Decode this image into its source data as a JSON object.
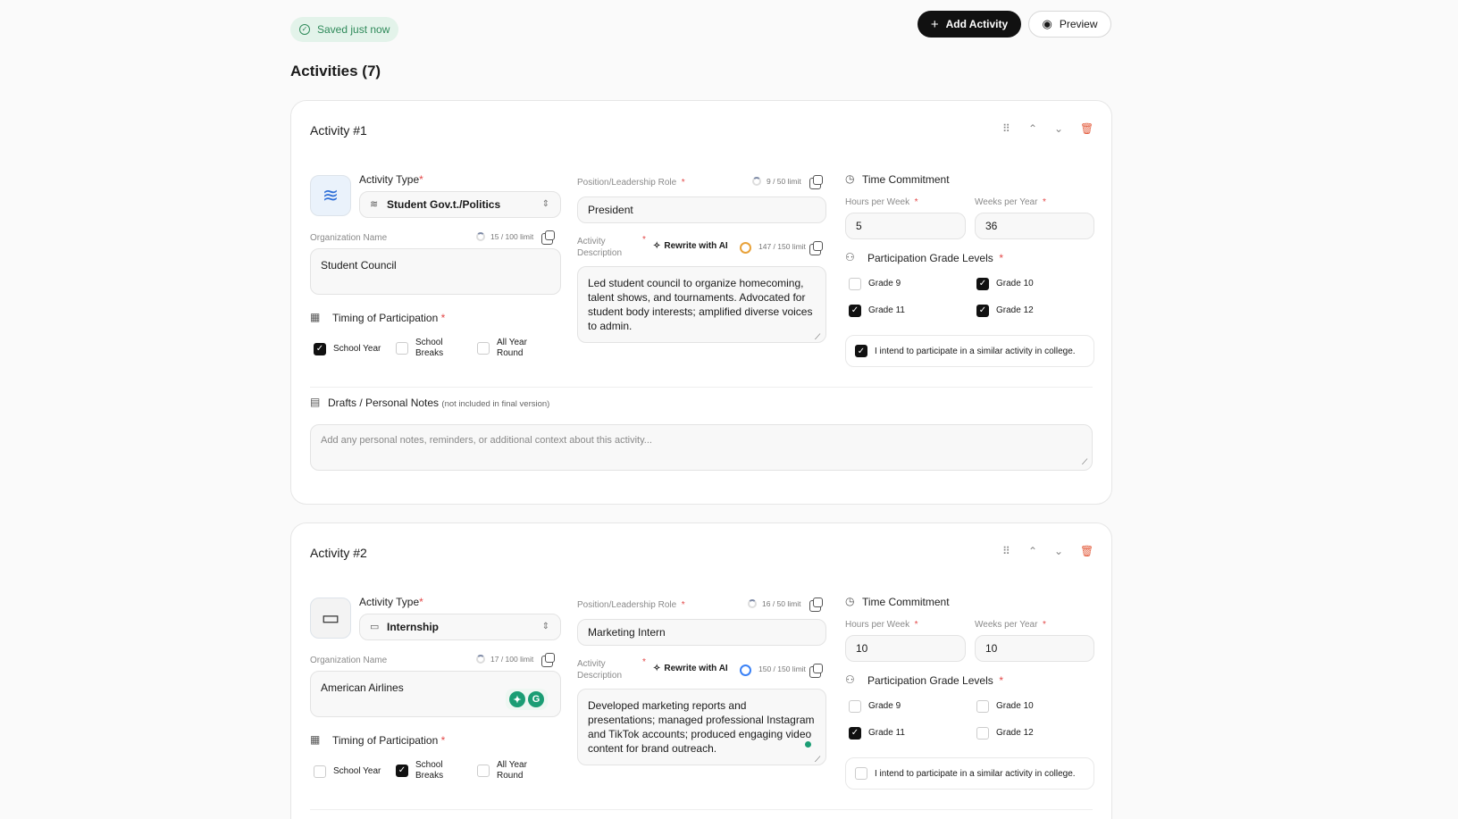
{
  "header": {
    "saved_label": "Saved just now",
    "add_activity_label": "Add Activity",
    "preview_label": "Preview",
    "page_title": "Activities (7)"
  },
  "labels": {
    "activity_type": "Activity Type",
    "org_name": "Organization Name",
    "timing": "Timing of Participation",
    "position": "Position/Leadership Role",
    "description_line1": "Activity",
    "description_line2": "Description",
    "rewrite": "Rewrite with AI",
    "time_commitment": "Time Commitment",
    "hours_per_week": "Hours per Week",
    "weeks_per_year": "Weeks per Year",
    "grade_levels": "Participation Grade Levels",
    "intend": "I intend to participate in a similar activity in college.",
    "drafts": "Drafts / Personal Notes",
    "drafts_note": "(not included in final version)",
    "notes_placeholder": "Add any personal notes, reminders, or additional context about this activity...",
    "school_year": "School Year",
    "school_breaks_1": "School",
    "school_breaks_2": "Breaks",
    "all_year_1": "All Year",
    "all_year_2": "Round",
    "grade9": "Grade 9",
    "grade10": "Grade 10",
    "grade11": "Grade 11",
    "grade12": "Grade 12"
  },
  "activities": [
    {
      "title": "Activity  #1",
      "type": "Student Gov.t./Politics",
      "type_icon": "handshake-icon",
      "org_name": "Student Council",
      "org_count": "15 / 100 limit",
      "position": "President",
      "position_count": "9 / 50 limit",
      "description": "Led student council to organize homecoming, talent shows, and tournaments. Advocated for student body interests; amplified diverse voices to admin.",
      "desc_count": "147 / 150 limit",
      "desc_ring_color": "#e8a23a",
      "hours": "5",
      "weeks": "36",
      "timing": {
        "school_year": true,
        "school_breaks": false,
        "all_year": false
      },
      "grades": {
        "g9": false,
        "g10": true,
        "g11": true,
        "g12": true
      },
      "intend": true
    },
    {
      "title": "Activity  #2",
      "type": "Internship",
      "type_icon": "briefcase-icon",
      "org_name": "American Airlines",
      "org_count": "17 / 100 limit",
      "position": "Marketing Intern",
      "position_count": "16 / 50 limit",
      "description": "Developed marketing reports and presentations; managed professional Instagram and TikTok accounts; produced engaging video content for brand outreach.",
      "desc_count": "150 / 150 limit",
      "desc_ring_color": "#3b82f6",
      "hours": "10",
      "weeks": "10",
      "timing": {
        "school_year": false,
        "school_breaks": true,
        "all_year": false
      },
      "grades": {
        "g9": false,
        "g10": false,
        "g11": true,
        "g12": false
      },
      "intend": false
    }
  ]
}
